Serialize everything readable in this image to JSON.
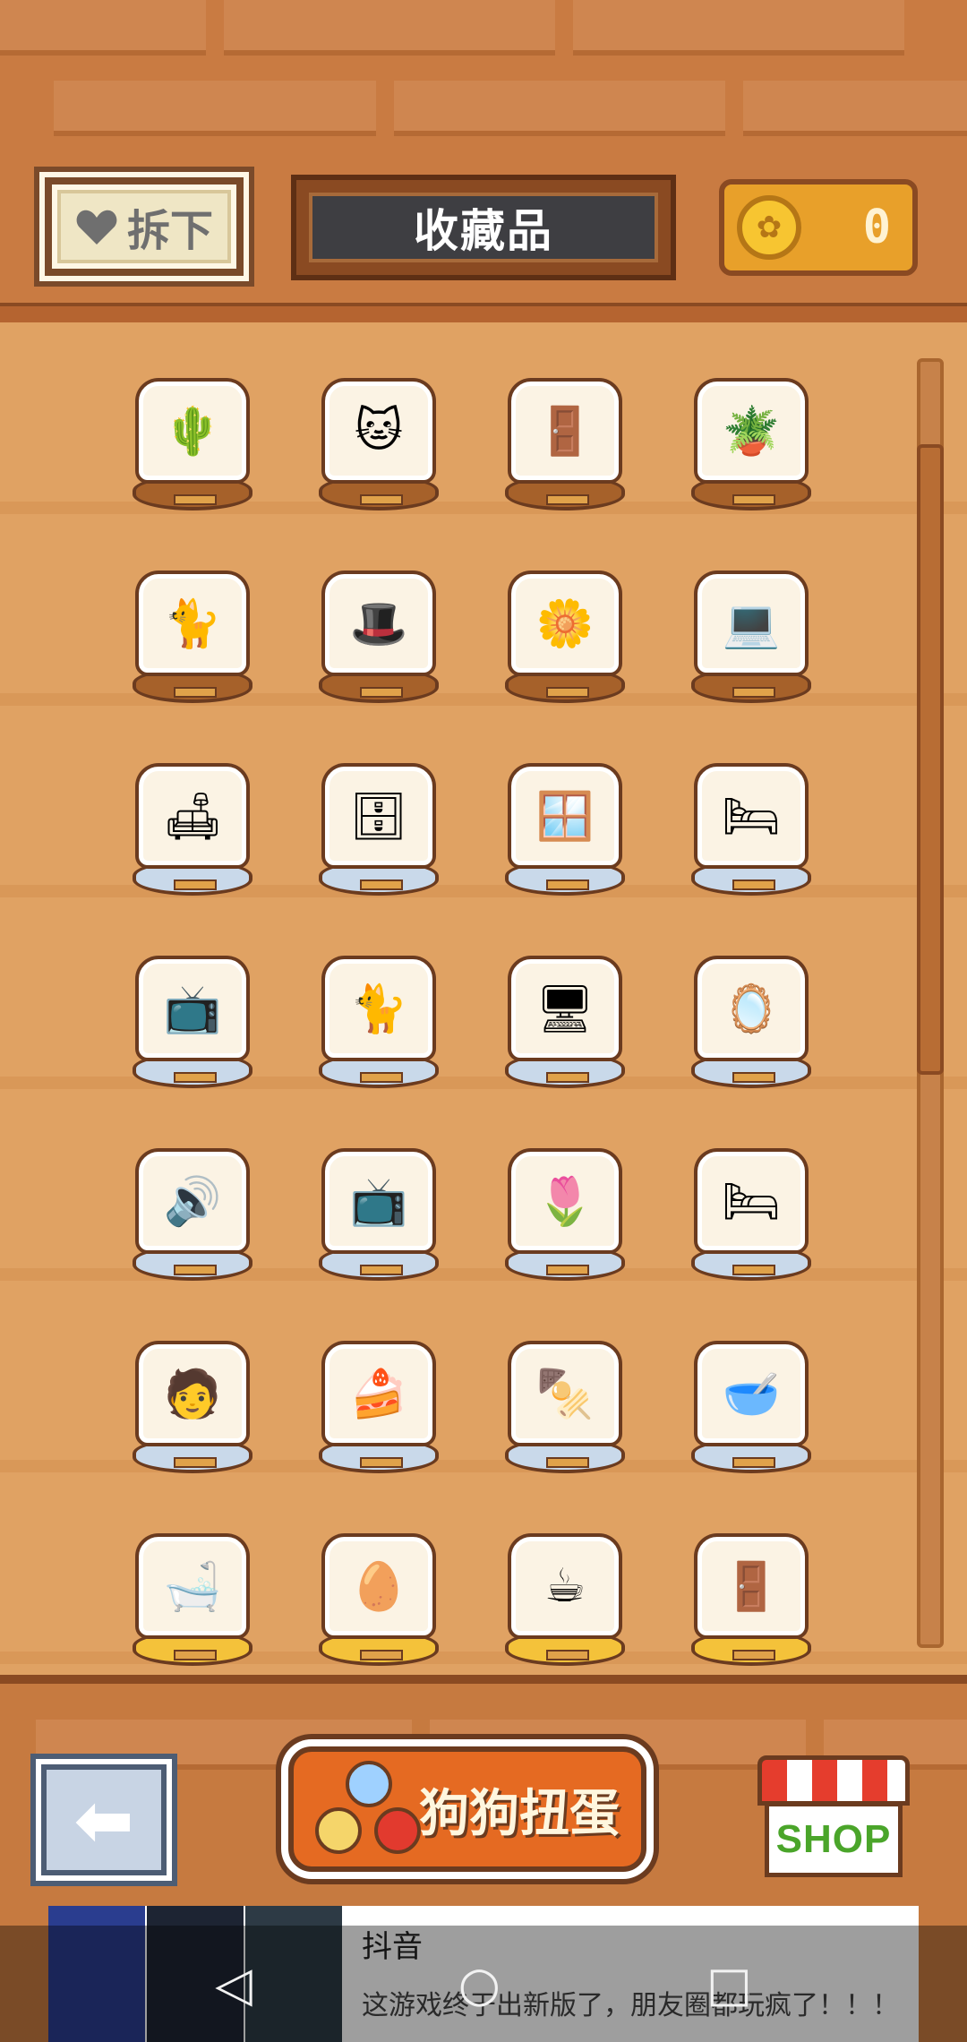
{
  "header": {
    "unpin_label": "拆下",
    "title": "收藏品",
    "coins": "0"
  },
  "collection": {
    "items": [
      {
        "name": "cat-with-cactus",
        "glyph": "🌵",
        "base": "wood"
      },
      {
        "name": "cat-on-coat-rack",
        "glyph": "🐱",
        "base": "wood"
      },
      {
        "name": "wardrobe",
        "glyph": "🚪",
        "base": "wood"
      },
      {
        "name": "cat-with-plant-stool",
        "glyph": "🪴",
        "base": "wood"
      },
      {
        "name": "curled-cat",
        "glyph": "🐈",
        "base": "wood"
      },
      {
        "name": "cat-with-hat",
        "glyph": "🎩",
        "base": "wood"
      },
      {
        "name": "cat-with-flowers",
        "glyph": "🌼",
        "base": "wood"
      },
      {
        "name": "cat-with-laptop",
        "glyph": "💻",
        "base": "wood"
      },
      {
        "name": "cat-on-armchair",
        "glyph": "🛋",
        "base": "silver"
      },
      {
        "name": "cat-in-cabinet",
        "glyph": "🗄",
        "base": "silver"
      },
      {
        "name": "cat-at-window",
        "glyph": "🪟",
        "base": "silver"
      },
      {
        "name": "cat-on-bed",
        "glyph": "🛏",
        "base": "silver"
      },
      {
        "name": "tv-cabinet",
        "glyph": "📺",
        "base": "silver"
      },
      {
        "name": "green-cat",
        "glyph": "🐈",
        "base": "silver"
      },
      {
        "name": "cat-computer",
        "glyph": "🖥",
        "base": "silver"
      },
      {
        "name": "cat-mirror",
        "glyph": "🪞",
        "base": "silver"
      },
      {
        "name": "cat-with-speaker",
        "glyph": "🔊",
        "base": "silver"
      },
      {
        "name": "tv-stand",
        "glyph": "📺",
        "base": "silver"
      },
      {
        "name": "cat-with-planter",
        "glyph": "🌷",
        "base": "silver"
      },
      {
        "name": "cat-in-bed-cushion",
        "glyph": "🛏",
        "base": "silver"
      },
      {
        "name": "cat-with-owner",
        "glyph": "🧑",
        "base": "silver"
      },
      {
        "name": "cat-under-table",
        "glyph": "🍰",
        "base": "silver"
      },
      {
        "name": "cat-with-skewer",
        "glyph": "🍢",
        "base": "silver"
      },
      {
        "name": "cat-with-bowls",
        "glyph": "🥣",
        "base": "silver"
      },
      {
        "name": "cat-in-bathtub",
        "glyph": "🛁",
        "base": "gold"
      },
      {
        "name": "cat-with-mirror-egg",
        "glyph": "🥚",
        "base": "gold"
      },
      {
        "name": "cat-at-cafe",
        "glyph": "☕",
        "base": "gold"
      },
      {
        "name": "cat-doorway",
        "glyph": "🚪",
        "base": "gold"
      }
    ]
  },
  "footer": {
    "gacha_label": "狗狗扭蛋",
    "shop_label": "SHOP"
  },
  "ad": {
    "title": "抖音",
    "description": "这游戏终于出新版了，朋友圈都玩疯了！！！"
  },
  "icons": {
    "unpin": "heart-icon",
    "coin": "paw-coin-icon",
    "back": "back-arrow-icon",
    "gacha": "gacha-balls-icon",
    "shop": "shop-awning-icon"
  },
  "colors": {
    "wall": "#c97b42",
    "floor": "#e0a263",
    "title_bg": "#3e3e42",
    "coin_box": "#e8a02a",
    "gacha_button": "#e56a22",
    "shop_text": "#4aa52a"
  }
}
